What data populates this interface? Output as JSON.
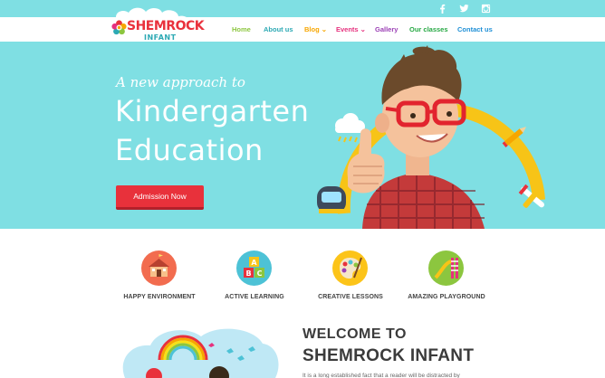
{
  "social": {
    "icons": [
      "facebook-icon",
      "twitter-icon",
      "instagram-icon"
    ]
  },
  "logo": {
    "title": "SHEMROCK",
    "subtitle": "INFANT"
  },
  "nav": {
    "items": [
      {
        "label": "Home",
        "color": "#8cc63f"
      },
      {
        "label": "About us",
        "color": "#2ca9b4"
      },
      {
        "label": "Blog ⌄",
        "color": "#f7a600"
      },
      {
        "label": "Events ⌄",
        "color": "#e6317e"
      },
      {
        "label": "Gallery",
        "color": "#9b3fb5"
      },
      {
        "label": "Our classes",
        "color": "#27a844"
      },
      {
        "label": "Contact us",
        "color": "#1e8fd6"
      }
    ]
  },
  "hero": {
    "tagline": "A new approach to",
    "headline_line1": "Kindergarten",
    "headline_line2": "Education",
    "cta_label": "Admission Now",
    "background": "#7fdfe3",
    "cta_color": "#e8313b"
  },
  "features": [
    {
      "label": "HAPPY ENVIRONMENT",
      "icon": "school-icon",
      "color": "#f26c4f"
    },
    {
      "label": "ACTIVE LEARNING",
      "icon": "abc-blocks-icon",
      "color": "#4dc2d6"
    },
    {
      "label": "CREATIVE LESSONS",
      "icon": "palette-icon",
      "color": "#fcc419"
    },
    {
      "label": "AMAZING PLAYGROUND",
      "icon": "slide-icon",
      "color": "#8cc63f"
    }
  ],
  "welcome": {
    "title_line1": "WELCOME TO",
    "title_line2": "SHEMROCK INFANT",
    "text": "It is a long established fact that a reader will be distracted by"
  }
}
